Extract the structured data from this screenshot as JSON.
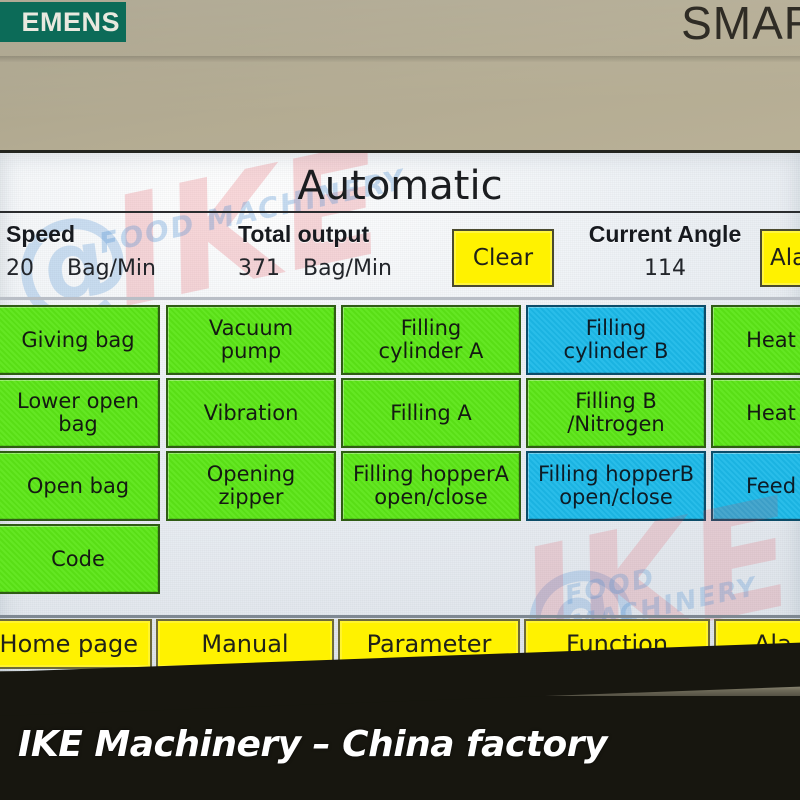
{
  "device": {
    "brand": "SIEMENS",
    "brand_visible_text": "EMENS",
    "model_line": "SMAR",
    "brand_color": "#0c6b58"
  },
  "screen": {
    "title": "Automatic",
    "accent_green": "#5ce617",
    "accent_blue": "#1cb9e8",
    "accent_yellow": "#fff200"
  },
  "header": {
    "speed": {
      "label": "Speed",
      "value": "20",
      "unit": "Bag/Min"
    },
    "total_output": {
      "label": "Total output",
      "value": "371",
      "unit": "Bag/Min"
    },
    "clear_button": "Clear",
    "current_angle": {
      "label": "Current Angle",
      "value": "114"
    },
    "alarm_button": "Ala"
  },
  "grid": {
    "rows": [
      [
        {
          "label": "Giving bag",
          "state": "green"
        },
        {
          "label": "Vacuum pump",
          "state": "green"
        },
        {
          "label": "Filling cylinder A",
          "state": "green"
        },
        {
          "label": "Filling cylinder B",
          "state": "blue"
        },
        {
          "label": "Heat",
          "state": "green"
        }
      ],
      [
        {
          "label": "Lower open bag",
          "state": "green"
        },
        {
          "label": "Vibration",
          "state": "green"
        },
        {
          "label": "Filling A",
          "state": "green"
        },
        {
          "label": "Filling B /Nitrogen",
          "state": "green"
        },
        {
          "label": "Heat",
          "state": "green"
        }
      ],
      [
        {
          "label": "Open bag",
          "state": "green"
        },
        {
          "label": "Opening zipper",
          "state": "green"
        },
        {
          "label": "Filling hopperA open/close",
          "state": "green"
        },
        {
          "label": "Filling hopperB open/close",
          "state": "blue"
        },
        {
          "label": "Feed",
          "state": "blue"
        }
      ],
      [
        {
          "label": "Code",
          "state": "green"
        }
      ]
    ]
  },
  "nav": {
    "items": [
      {
        "label": "Home page"
      },
      {
        "label": "Manual"
      },
      {
        "label": "Parameter"
      },
      {
        "label": "Function"
      },
      {
        "label": "Ala"
      }
    ]
  },
  "watermarks": {
    "brand_mark": "IKE",
    "brand_tagline": "FOOD MACHINERY",
    "at_glyph": "@",
    "caption": "IKE Machinery – China factory"
  }
}
